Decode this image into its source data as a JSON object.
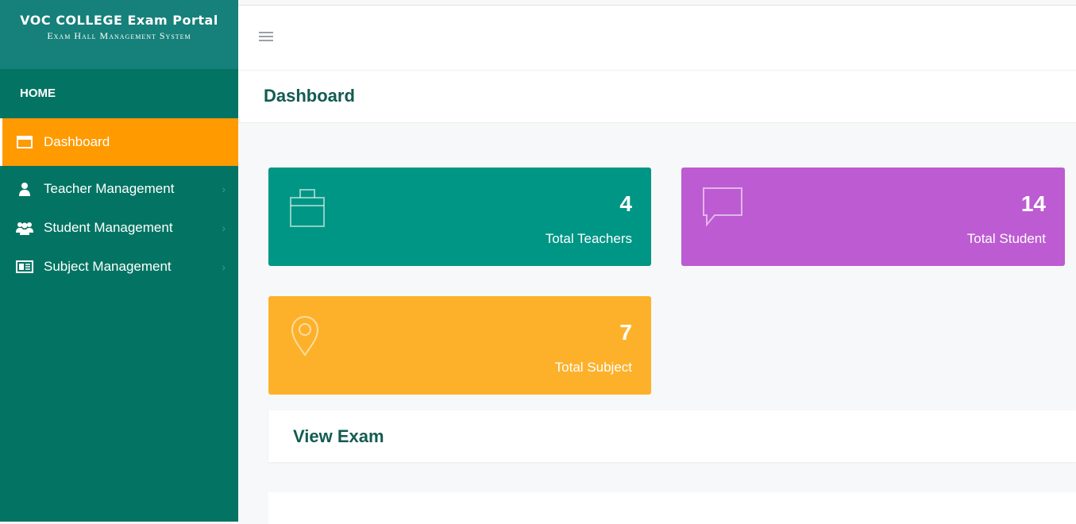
{
  "brand": {
    "title": "VOC COLLEGE Exam Portal",
    "subtitle": "Exam Hall Management System"
  },
  "sidebar": {
    "heading": "HOME",
    "items": [
      {
        "label": "Dashboard",
        "icon": "window-icon",
        "active": true
      },
      {
        "label": "Teacher Management",
        "icon": "user-icon"
      },
      {
        "label": "Student Management",
        "icon": "users-icon"
      },
      {
        "label": "Subject Management",
        "icon": "newspaper-icon"
      }
    ]
  },
  "header": {
    "menu_icon": "hamburger-icon"
  },
  "page": {
    "title": "Dashboard"
  },
  "cards": [
    {
      "value": "4",
      "label": "Total Teachers",
      "icon": "briefcase-icon",
      "color": "#009685"
    },
    {
      "value": "14",
      "label": "Total Student",
      "icon": "chat-bubble-icon",
      "color": "#bd5bd2"
    },
    {
      "value": "7",
      "label": "Total Subject",
      "icon": "map-pin-icon",
      "color": "#fdb12b"
    }
  ],
  "panel": {
    "title": "View Exam"
  }
}
